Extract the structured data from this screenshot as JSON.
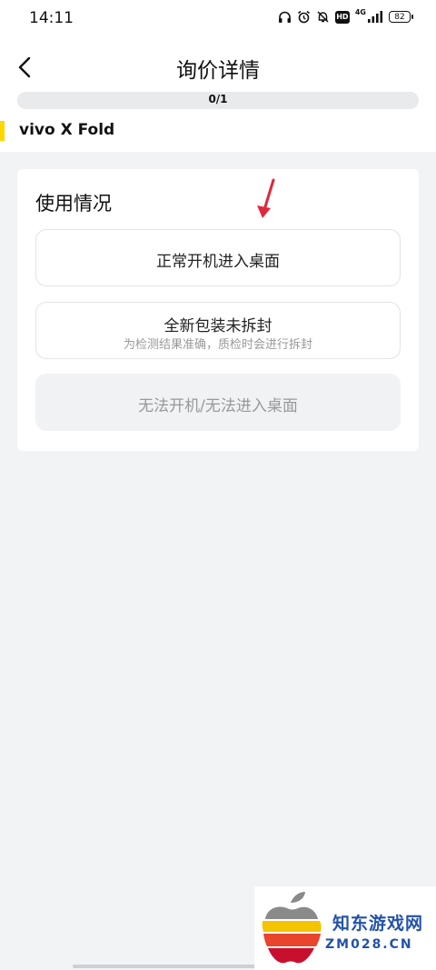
{
  "status_bar": {
    "time": "14:11",
    "network": "4G",
    "hd": "HD",
    "battery": "82"
  },
  "nav": {
    "title": "询价详情"
  },
  "progress": {
    "text": "0/1",
    "fraction": 0
  },
  "model": {
    "name": "vivo X Fold"
  },
  "usage": {
    "title": "使用情况",
    "options": [
      {
        "label": "正常开机进入桌面"
      },
      {
        "label": "全新包装未拆封",
        "sublabel": "为检测结果准确，质检时会进行拆封"
      },
      {
        "label": "无法开机/无法进入桌面",
        "state": "disabled"
      }
    ]
  },
  "watermark": {
    "title": "知东游戏网",
    "subtitle": "ZM028.CN"
  },
  "colors": {
    "accent": "#ffd600",
    "annotation_arrow": "#e0283c",
    "watermark_text": "#2352a8"
  }
}
